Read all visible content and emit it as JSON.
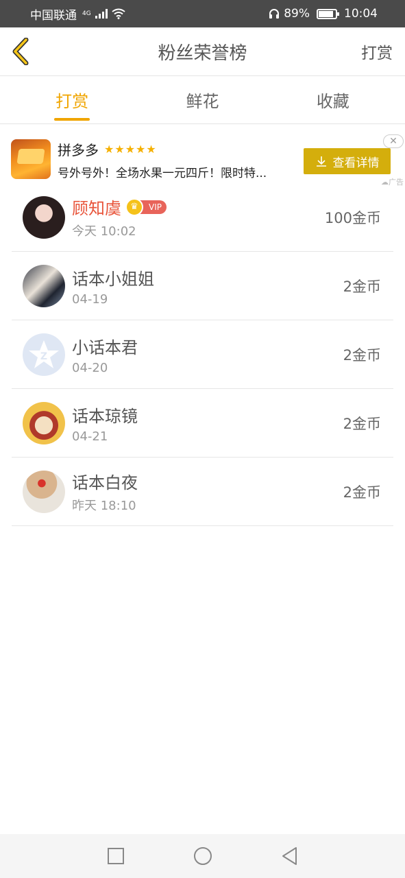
{
  "status_bar": {
    "carrier": "中国联通",
    "network": "4G",
    "battery": "89%",
    "battery_level": 0.89,
    "time": "10:04"
  },
  "nav": {
    "title": "粉丝荣誉榜",
    "action": "打赏"
  },
  "tabs": [
    {
      "label": "打赏",
      "active": true
    },
    {
      "label": "鲜花",
      "active": false
    },
    {
      "label": "收藏",
      "active": false
    }
  ],
  "ad": {
    "name": "拼多多",
    "stars": "★★★★★",
    "description": "号外号外！全场水果一元四斤！限时特...",
    "button": "查看详情",
    "tag": "广告"
  },
  "colors": {
    "accent": "#f0a500",
    "vip_name": "#e8543a",
    "ad_button": "#d4ae0c"
  },
  "entries": [
    {
      "name": "顾知虞",
      "vip": true,
      "vip_label": "VIP",
      "time": "今天 10:02",
      "amount": "100金币"
    },
    {
      "name": "话本小姐姐",
      "vip": false,
      "time": "04-19",
      "amount": "2金币"
    },
    {
      "name": "小话本君",
      "vip": false,
      "time": "04-20",
      "amount": "2金币"
    },
    {
      "name": "话本琼镜",
      "vip": false,
      "time": "04-21",
      "amount": "2金币"
    },
    {
      "name": "话本白夜",
      "vip": false,
      "time": "昨天 18:10",
      "amount": "2金币"
    }
  ]
}
